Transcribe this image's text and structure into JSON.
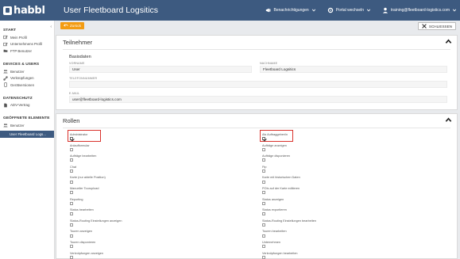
{
  "app": {
    "brand": "habbl",
    "title": "User Fleetboard Logsitics"
  },
  "topbar": {
    "notifications_label": "Benachrichtigungen",
    "portal_switch_label": "Portal wechseln",
    "user_email": "training@fleetboard-logistics.com"
  },
  "sidebar": {
    "sections": [
      {
        "heading": "START",
        "items": [
          {
            "label": "Mein Profil",
            "icon": "edit-icon"
          },
          {
            "label": "Unternehmens Profil",
            "icon": "edit-icon"
          },
          {
            "label": "FTP Benutzer",
            "icon": "folder-icon"
          }
        ]
      },
      {
        "heading": "DEVICES & USERS",
        "items": [
          {
            "label": "Benutzer",
            "icon": "users-icon"
          },
          {
            "label": "Verknüpfungen",
            "icon": "link-icon"
          },
          {
            "label": "Gerätversionen",
            "icon": "device-icon"
          }
        ]
      },
      {
        "heading": "DATENSCHUTZ",
        "items": [
          {
            "label": "ADV-Vertrag",
            "icon": "document-icon"
          }
        ]
      },
      {
        "heading": "GEÖFFNETE ELEMENTE",
        "items": [
          {
            "label": "Benutzer",
            "icon": "users-icon"
          }
        ]
      }
    ],
    "active_item": "User Fleetboard Logs..."
  },
  "actions": {
    "back_label": "Zurück",
    "close_label": "SCHLIESSEN"
  },
  "participant": {
    "title": "Teilnehmer",
    "subtitle": "Basisdaten",
    "fields": {
      "firstname_label": "VORNAME",
      "firstname_value": "User",
      "lastname_label": "NACHNAME",
      "lastname_value": "Fleetboard Logsitics",
      "phone_label": "TELEFONNUMMER",
      "phone_value": "",
      "email_label": "E-MAIL",
      "email_value": "user@fleetboard-logistics.com"
    }
  },
  "roles": {
    "title": "Rollen",
    "left": [
      {
        "label": "Administrator",
        "checked": true
      },
      {
        "label": "Anlaufformular",
        "checked": false
      },
      {
        "label": "Aufträge bearbeiten",
        "checked": false
      },
      {
        "label": "Chat",
        "checked": false
      },
      {
        "label": "Karte (nur aktelle Position)",
        "checked": false
      },
      {
        "label": "Manueller Tourupload",
        "checked": false
      },
      {
        "label": "Reporting",
        "checked": false
      },
      {
        "label": "Status bearbeiten",
        "checked": false
      },
      {
        "label": "Status-Routing Einstellungen anzeigen",
        "checked": false
      },
      {
        "label": "Touren anzeigen",
        "checked": false
      },
      {
        "label": "Touren disponieren",
        "checked": false
      },
      {
        "label": "Verknüpfungen anzeigen",
        "checked": false
      }
    ],
    "right": [
      {
        "label": "Als Auftraggeber/in",
        "checked": true
      },
      {
        "label": "Aufträge anzeigen",
        "checked": false
      },
      {
        "label": "Aufträge disponieren",
        "checked": false
      },
      {
        "label": "Ftp",
        "checked": false
      },
      {
        "label": "Karte mit historischen Daten",
        "checked": false
      },
      {
        "label": "POIs auf der Karte editieren",
        "checked": false
      },
      {
        "label": "Status anzeigen",
        "checked": false
      },
      {
        "label": "Status exportieren",
        "checked": false
      },
      {
        "label": "Status-Routing Einstellungen bearbeiten",
        "checked": false
      },
      {
        "label": "Touren bearbeiten",
        "checked": false
      },
      {
        "label": "Unternehmen",
        "checked": false
      },
      {
        "label": "Verknüpfungen bearbeiten",
        "checked": false
      }
    ]
  },
  "colors": {
    "topbar": "#3d5a80",
    "accent_orange": "#f39c12",
    "highlight_red": "#d9322c"
  }
}
